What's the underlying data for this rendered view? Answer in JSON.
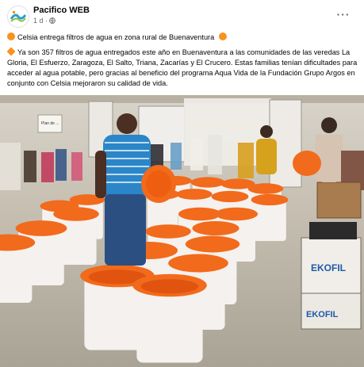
{
  "post": {
    "page_name": "Pacifico WEB",
    "time_ago": "1 d ·",
    "privacy_icon": "globe-icon",
    "more_icon": "more-options-icon",
    "paragraph_1": "Celsia entrega filtros de agua en zona rural de Buenaventura",
    "paragraph_2": "Ya son 357 filtros de agua entregados este año en Buenaventura a las comunidades de las veredas La Gloria, El Esfuerzo, Zaragoza, El Salto, Triana, Zacarías y El Crucero. Estas familias tenían dificultades para acceder al agua potable, pero gracias al beneficio del programa Aqua Vida de la Fundación Grupo Argos en conjunto con Celsia mejoraron su calidad de vida."
  },
  "photo": {
    "wall_sign": "Plan de ...",
    "box_brand": "EKOFIL",
    "colors": {
      "filter_orange": "#f26a1b",
      "filter_white": "#f4f1ee",
      "shirt_blue": "#2a86c9"
    }
  }
}
